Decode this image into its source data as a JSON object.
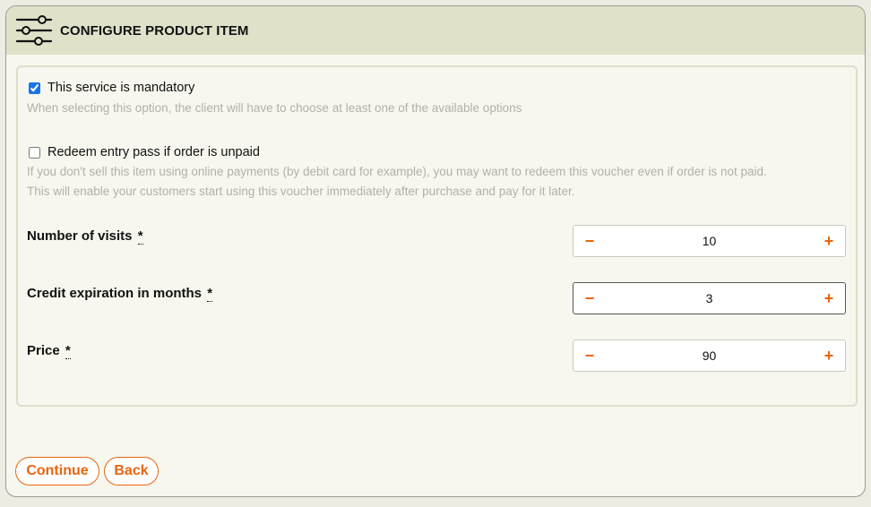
{
  "header": {
    "title": "CONFIGURE PRODUCT ITEM",
    "icon": "sliders-icon"
  },
  "options": {
    "mandatory": {
      "label": "This service is mandatory",
      "checked": true,
      "hint": "When selecting this option, the client will have to choose at least one of the available options"
    },
    "redeem": {
      "label": "Redeem entry pass if order is unpaid",
      "checked": false,
      "hint_line1": "If you don't sell this item using online payments (by debit card for example), you may want to redeem this voucher even if order is not paid.",
      "hint_line2": "This will enable your customers start using this voucher immediately after purchase and pay for it later."
    }
  },
  "fields": {
    "visits": {
      "label": "Number of visits",
      "required_mark": "*",
      "value": "10"
    },
    "expiration": {
      "label": "Credit expiration in months",
      "required_mark": "*",
      "value": "3"
    },
    "price": {
      "label": "Price",
      "required_mark": "*",
      "value": "90"
    }
  },
  "stepper": {
    "minus": "−",
    "plus": "+"
  },
  "actions": {
    "continue_label": "Continue",
    "back_label": "Back"
  },
  "colors": {
    "accent": "#e8650f",
    "header_bg": "#dfe1c9",
    "hint_text": "#b1b1a8"
  }
}
